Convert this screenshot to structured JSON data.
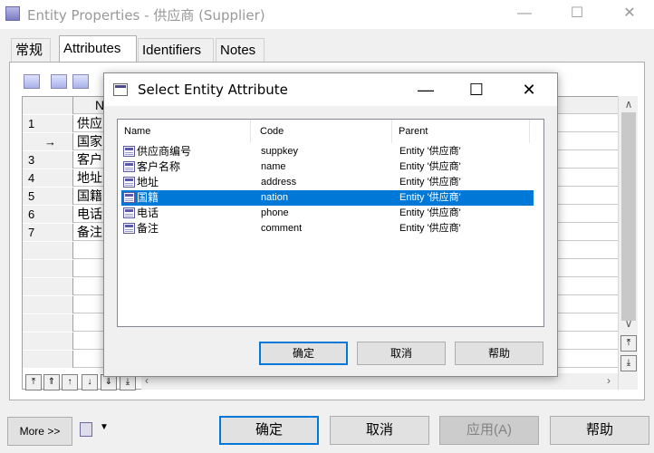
{
  "window": {
    "title": "Entity Properties - 供应商 (Supplier)",
    "minimize": "—",
    "maximize": "☐",
    "close": "✕"
  },
  "tabs": [
    "常规",
    "Attributes",
    "Identifiers",
    "Notes"
  ],
  "active_tab": "Attributes",
  "grid": {
    "column_header": "N",
    "rows": [
      {
        "head": "1",
        "cell": "供应"
      },
      {
        "head": "→",
        "cell": "国家"
      },
      {
        "head": "3",
        "cell": "客户"
      },
      {
        "head": "4",
        "cell": "地址"
      },
      {
        "head": "5",
        "cell": "国籍"
      },
      {
        "head": "6",
        "cell": "电话"
      },
      {
        "head": "7",
        "cell": "备注"
      }
    ]
  },
  "nav_buttons": [
    "⤒",
    "⇑",
    "↑",
    "↓",
    "⇓",
    "⤓"
  ],
  "bottom": {
    "more_label": "More >>",
    "ok_label": "确定",
    "cancel_label": "取消",
    "apply_label": "应用(A)",
    "help_label": "帮助"
  },
  "dialog": {
    "title": "Select Entity Attribute",
    "minimize": "—",
    "maximize": "☐",
    "close": "✕",
    "columns": {
      "name": "Name",
      "code": "Code",
      "parent": "Parent"
    },
    "rows": [
      {
        "name": "供应商编号",
        "code": "suppkey",
        "parent": "Entity '供应商'"
      },
      {
        "name": "客户名称",
        "code": "name",
        "parent": "Entity '供应商'"
      },
      {
        "name": "地址",
        "code": "address",
        "parent": "Entity '供应商'"
      },
      {
        "name": "国籍",
        "code": "nation",
        "parent": "Entity '供应商'"
      },
      {
        "name": "电话",
        "code": "phone",
        "parent": "Entity '供应商'"
      },
      {
        "name": "备注",
        "code": "comment",
        "parent": "Entity '供应商'"
      }
    ],
    "selected_row": "国籍",
    "ok_label": "确定",
    "cancel_label": "取消",
    "help_label": "帮助"
  },
  "colors": {
    "selection": "#0078d7",
    "button_face": "#e1e1e1",
    "window_bg": "#f0f0f0"
  }
}
